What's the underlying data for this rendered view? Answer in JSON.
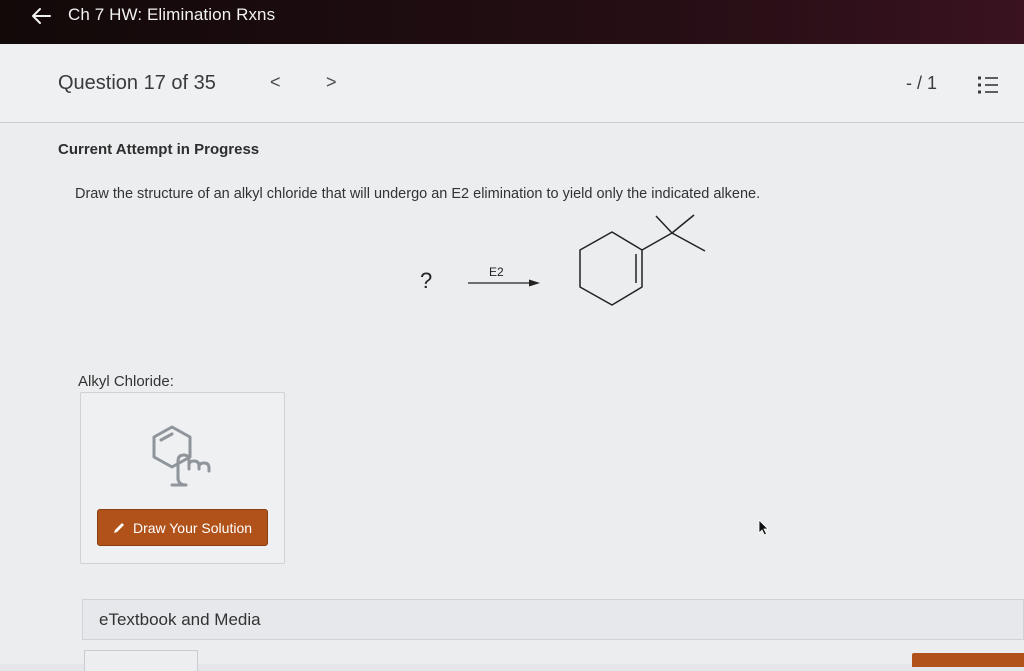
{
  "topbar": {
    "title": "Ch 7 HW: Elimination Rxns",
    "back_icon": "arrow-left-icon"
  },
  "question_header": {
    "counter": "Question 17 of 35",
    "prev": "<",
    "next": ">",
    "score": "- / 1",
    "list_icon": "list-icon"
  },
  "main": {
    "attempt_status": "Current Attempt in Progress",
    "question_text": "Draw the structure of an alkyl chloride that will undergo an E2 elimination to yield only the indicated alkene.",
    "reaction": {
      "reactant": "?",
      "arrow_label": "E2",
      "product": "1-tert-butylcyclohexene"
    },
    "answer_label": "Alkyl Chloride:",
    "draw_button": "Draw Your Solution",
    "etextbook": "eTextbook and Media"
  },
  "colors": {
    "accent": "#b0521a",
    "topbar": "#1d0c10"
  }
}
